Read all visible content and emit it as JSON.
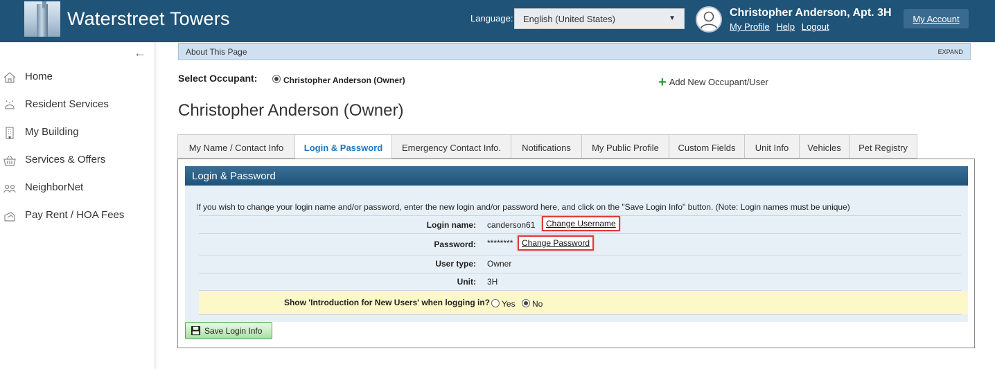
{
  "header": {
    "site_title": "Waterstreet Towers",
    "language_label": "Language:",
    "language_selected": "English (United States)",
    "user_name": "Christopher Anderson, Apt. 3H",
    "links": {
      "my_profile": "My Profile",
      "help": "Help",
      "logout": "Logout"
    },
    "my_account": "My Account",
    "colors": {
      "bar": "#1f5378"
    }
  },
  "sidebar": {
    "items": [
      {
        "label": "Home",
        "icon": "home-icon"
      },
      {
        "label": "Resident Services",
        "icon": "bell-icon"
      },
      {
        "label": "My Building",
        "icon": "building-icon"
      },
      {
        "label": "Services & Offers",
        "icon": "basket-icon"
      },
      {
        "label": "NeighborNet",
        "icon": "people-icon"
      },
      {
        "label": "Pay Rent / HOA Fees",
        "icon": "payment-icon"
      }
    ]
  },
  "about": {
    "title": "About This Page",
    "expand": "EXPAND"
  },
  "occupant": {
    "label": "Select Occupant:",
    "selected": "Christopher Anderson (Owner)",
    "add_new": "Add New Occupant/User"
  },
  "page_heading": "Christopher Anderson (Owner)",
  "tabs": [
    {
      "label": "My Name / Contact Info"
    },
    {
      "label": "Login & Password",
      "active": true
    },
    {
      "label": "Emergency Contact Info."
    },
    {
      "label": "Notifications"
    },
    {
      "label": "My Public Profile"
    },
    {
      "label": "Custom Fields"
    },
    {
      "label": "Unit Info"
    },
    {
      "label": "Vehicles"
    },
    {
      "label": "Pet Registry"
    }
  ],
  "login_section": {
    "title": "Login & Password",
    "intro": "If you wish to change your login name and/or password, enter the new login and/or password here, and click on the \"Save Login Info\" button. (Note: Login names must be unique)",
    "fields": {
      "login_label": "Login name:",
      "login_value": "canderson61",
      "change_username": "Change Username",
      "password_label": "Password:",
      "password_value": "********",
      "change_password": "Change Password",
      "user_type_label": "User type:",
      "user_type_value": "Owner",
      "unit_label": "Unit:",
      "unit_value": "3H",
      "intro_label": "Show 'Introduction for New Users' when logging in?",
      "yes": "Yes",
      "no": "No",
      "intro_selected": "No"
    },
    "save_button": "Save Login Info"
  }
}
